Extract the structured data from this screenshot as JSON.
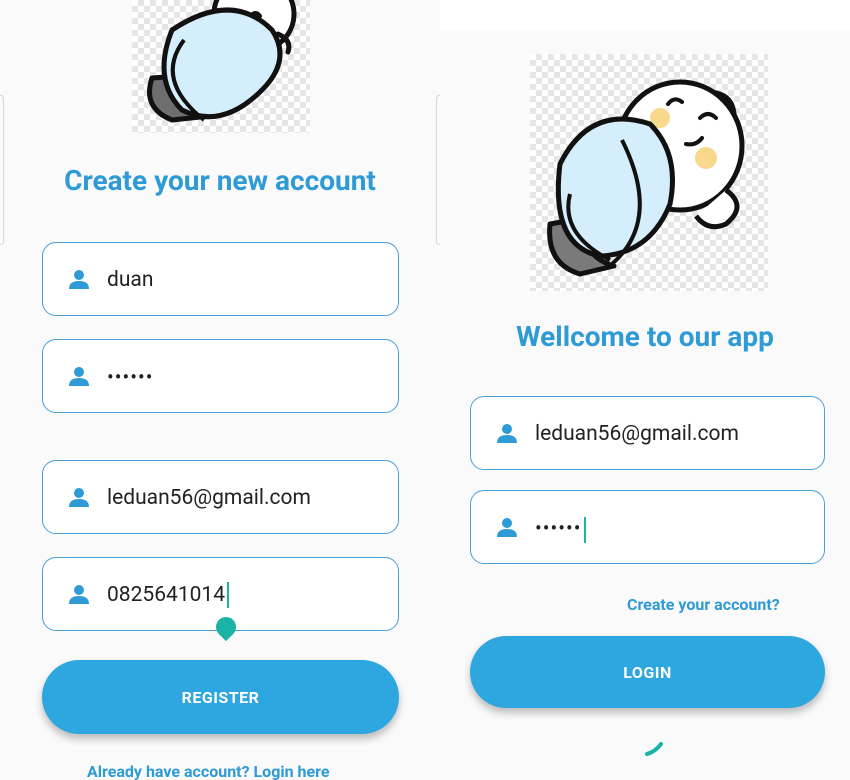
{
  "register": {
    "heading": "Create your new account",
    "fields": [
      {
        "icon": "person-icon",
        "value": "duan",
        "type": "text"
      },
      {
        "icon": "person-icon",
        "value": "••••••",
        "type": "password"
      },
      {
        "icon": "person-icon",
        "value": "leduan56@gmail.com",
        "type": "email"
      },
      {
        "icon": "person-icon",
        "value": "0825641014",
        "type": "phone"
      }
    ],
    "button_label": "REGISTER",
    "login_link": "Already have account? Login here"
  },
  "login": {
    "heading": "Wellcome to our app",
    "fields": [
      {
        "icon": "person-icon",
        "value": "leduan56@gmail.com",
        "type": "email"
      },
      {
        "icon": "person-icon",
        "value": "••••••",
        "type": "password"
      }
    ],
    "create_link": "Create your account?",
    "button_label": "LOGIN"
  },
  "colors": {
    "accent": "#2ea6df",
    "heading": "#2e9ad6",
    "field_border": "#4a9fd4",
    "caret": "#1ab3a6"
  }
}
